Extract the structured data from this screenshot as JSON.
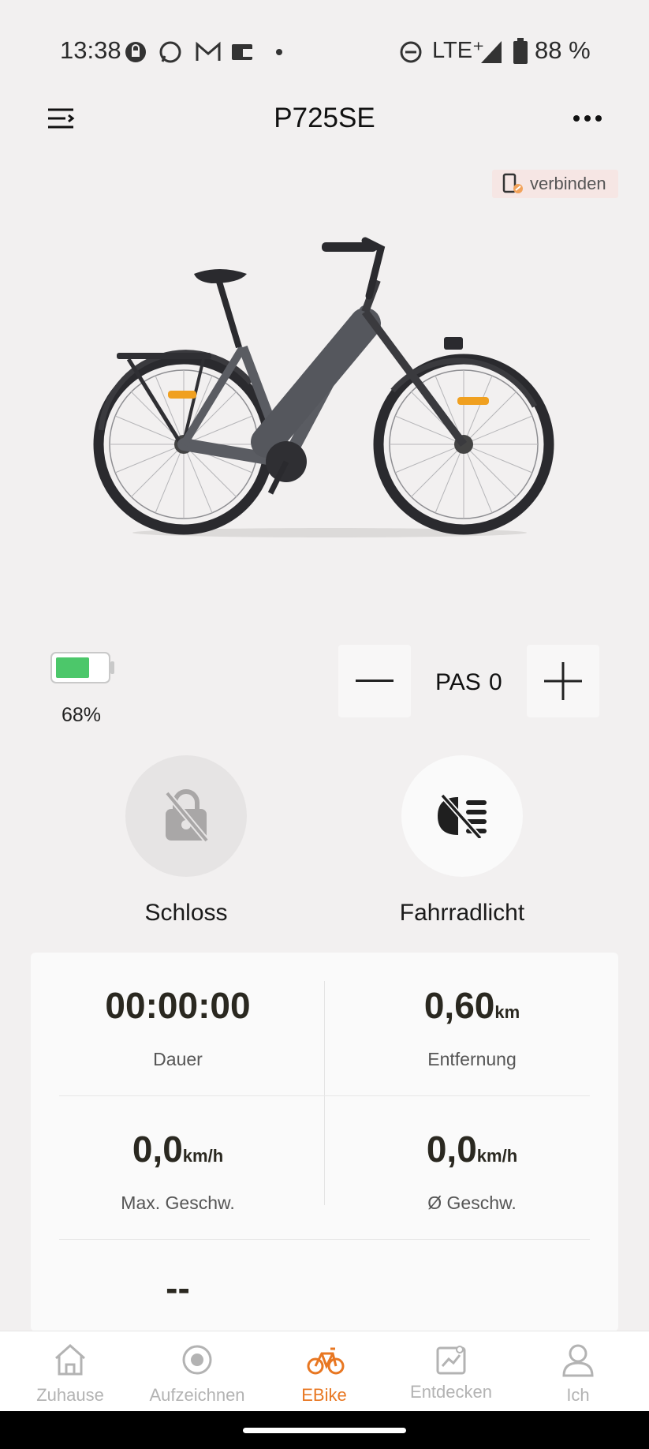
{
  "status_bar": {
    "time": "13:38",
    "network": "LTE⁺",
    "battery": "88 %"
  },
  "header": {
    "title": "P725SE"
  },
  "connect": {
    "label": "verbinden"
  },
  "battery": {
    "percent_label": "68%",
    "level": 0.68,
    "color": "#4cc76a"
  },
  "pas": {
    "label": "PAS",
    "value": "0"
  },
  "controls": {
    "lock_label": "Schloss",
    "light_label": "Fahrradlicht"
  },
  "stats": {
    "duration_value": "00:00:00",
    "duration_label": "Dauer",
    "distance_value": "0,60",
    "distance_unit": "km",
    "distance_label": "Entfernung",
    "max_speed_value": "0,0",
    "max_speed_unit": "km/h",
    "max_speed_label": "Max. Geschw.",
    "avg_speed_value": "0,0",
    "avg_speed_unit": "km/h",
    "avg_speed_label": "Ø Geschw.",
    "extra_value": "--"
  },
  "nav": {
    "items": [
      {
        "label": "Zuhause",
        "icon": "home-icon"
      },
      {
        "label": "Aufzeichnen",
        "icon": "record-icon"
      },
      {
        "label": "EBike",
        "icon": "bike-icon",
        "active": true
      },
      {
        "label": "Entdecken",
        "icon": "discover-icon"
      },
      {
        "label": "Ich",
        "icon": "profile-icon"
      }
    ]
  },
  "colors": {
    "accent": "#e87722",
    "background": "#f2f0f0"
  }
}
